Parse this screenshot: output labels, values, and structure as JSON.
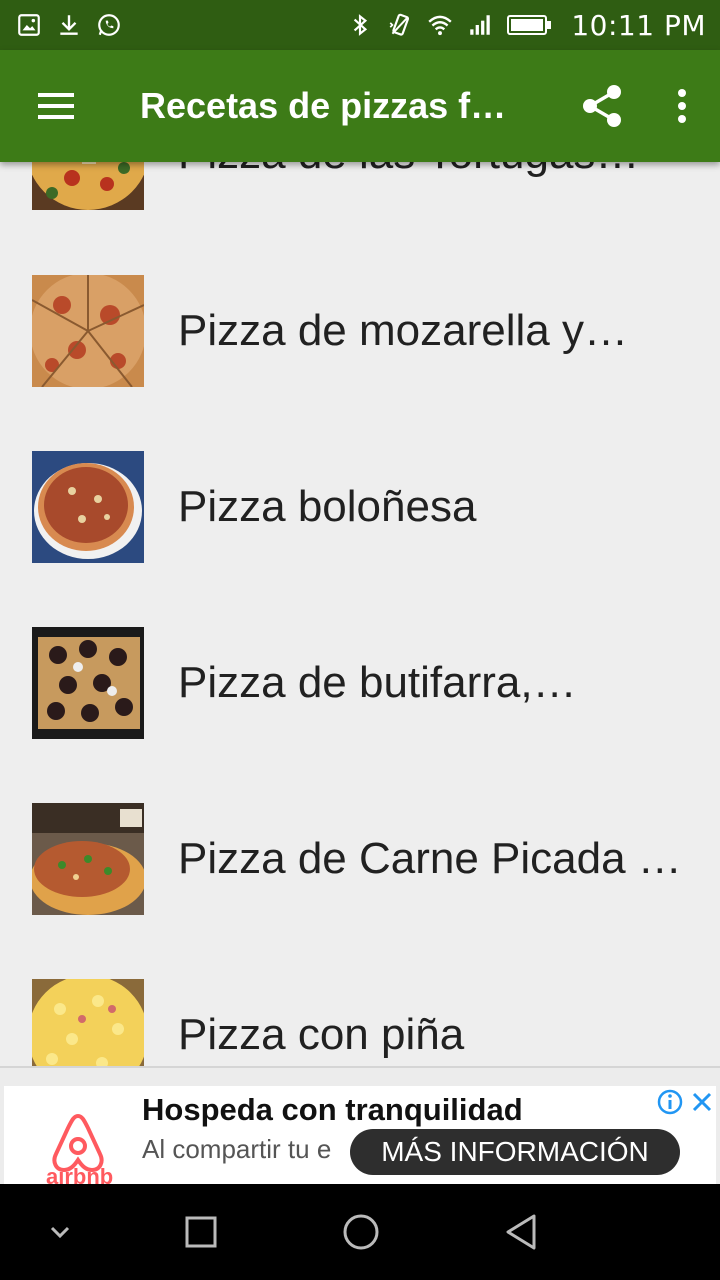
{
  "status_bar": {
    "time": "10:11 PM",
    "icons_left": [
      "gallery-icon",
      "download-icon",
      "whatsapp-icon"
    ],
    "icons_right": [
      "bluetooth-icon",
      "vibrate-icon",
      "wifi-icon",
      "signal-icon",
      "battery-icon"
    ]
  },
  "app_bar": {
    "title": "Recetas de pizzas f…",
    "menu_icon": "hamburger-menu-icon",
    "share_icon": "share-icon",
    "more_icon": "more-vert-icon",
    "background": "#3d7b17"
  },
  "list": {
    "items": [
      {
        "label": "Pizza de las Tortugas…",
        "thumb": "pizza-slices"
      },
      {
        "label": "Pizza de mozarella y…",
        "thumb": "pizza-cut"
      },
      {
        "label": "Pizza boloñesa",
        "thumb": "pizza-bolognese"
      },
      {
        "label": "Pizza de butifarra,…",
        "thumb": "pizza-butifarra"
      },
      {
        "label": "Pizza de Carne Picada …",
        "thumb": "pizza-meat"
      },
      {
        "label": "Pizza con piña",
        "thumb": "pizza-pineapple"
      }
    ]
  },
  "ad": {
    "brand": "airbnb",
    "headline": "Hospeda con tranquilidad",
    "body": "Al compartir tu e",
    "cta": "MÁS INFORMACIÓN",
    "info_icon": "info-icon",
    "close_icon": "close-icon",
    "brand_color": "#ff5a5f"
  },
  "nav_bar": {
    "buttons": [
      "collapse-icon",
      "recents-icon",
      "home-icon",
      "back-icon"
    ]
  }
}
